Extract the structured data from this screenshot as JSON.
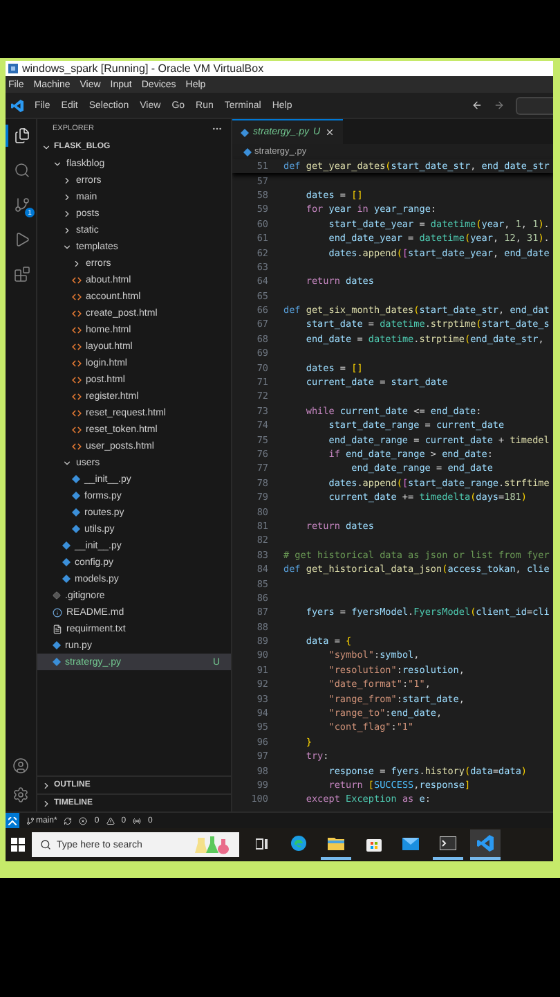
{
  "window": {
    "title": "windows_spark [Running] - Oracle VM VirtualBox"
  },
  "host_menu": [
    "File",
    "Machine",
    "View",
    "Input",
    "Devices",
    "Help"
  ],
  "menu": [
    "File",
    "Edit",
    "Selection",
    "View",
    "Go",
    "Run",
    "Terminal",
    "Help"
  ],
  "activity_bar": [
    {
      "kind": "files",
      "selected": true
    },
    {
      "kind": "search",
      "selected": false
    },
    {
      "kind": "source_control",
      "selected": false,
      "badge": "1"
    },
    {
      "kind": "run",
      "selected": false
    },
    {
      "kind": "extensions",
      "selected": false
    }
  ],
  "sidebar": {
    "title": "EXPLORER",
    "root": {
      "label": "FLASK_BLOG",
      "expanded": true,
      "children": [
        {
          "name": "flaskblog",
          "kind": "folder",
          "expanded": true,
          "selected": false,
          "children": [
            {
              "name": "errors",
              "kind": "folder",
              "expanded": false,
              "selected": false
            },
            {
              "name": "main",
              "kind": "folder",
              "expanded": false,
              "selected": false
            },
            {
              "name": "posts",
              "kind": "folder",
              "expanded": false,
              "selected": false
            },
            {
              "name": "static",
              "kind": "folder",
              "expanded": false,
              "selected": false
            },
            {
              "name": "templates",
              "kind": "folder",
              "expanded": true,
              "selected": false,
              "children": [
                {
                  "name": "errors",
                  "kind": "folder",
                  "expanded": false,
                  "selected": false
                },
                {
                  "name": "about.html",
                  "kind": "html",
                  "selected": false
                },
                {
                  "name": "account.html",
                  "kind": "html",
                  "selected": false
                },
                {
                  "name": "create_post.html",
                  "kind": "html",
                  "selected": false
                },
                {
                  "name": "home.html",
                  "kind": "html",
                  "selected": false
                },
                {
                  "name": "layout.html",
                  "kind": "html",
                  "selected": false
                },
                {
                  "name": "login.html",
                  "kind": "html",
                  "selected": false
                },
                {
                  "name": "post.html",
                  "kind": "html",
                  "selected": false
                },
                {
                  "name": "register.html",
                  "kind": "html",
                  "selected": false
                },
                {
                  "name": "reset_request.html",
                  "kind": "html",
                  "selected": false
                },
                {
                  "name": "reset_token.html",
                  "kind": "html",
                  "selected": false
                },
                {
                  "name": "user_posts.html",
                  "kind": "html",
                  "selected": false
                }
              ]
            },
            {
              "name": "users",
              "kind": "folder",
              "expanded": true,
              "selected": false,
              "children": [
                {
                  "name": "__init__.py",
                  "kind": "py",
                  "selected": false
                },
                {
                  "name": "forms.py",
                  "kind": "py",
                  "selected": false
                },
                {
                  "name": "routes.py",
                  "kind": "py",
                  "selected": false
                },
                {
                  "name": "utils.py",
                  "kind": "py",
                  "selected": false
                }
              ]
            },
            {
              "name": "__init__.py",
              "kind": "py",
              "selected": false
            },
            {
              "name": "config.py",
              "kind": "py",
              "selected": false
            },
            {
              "name": "models.py",
              "kind": "py",
              "selected": false
            }
          ]
        },
        {
          "name": ".gitignore",
          "kind": "gitignore",
          "selected": false
        },
        {
          "name": "README.md",
          "kind": "markdown",
          "selected": false
        },
        {
          "name": "requirment.txt",
          "kind": "text",
          "selected": false
        },
        {
          "name": "run.py",
          "kind": "py",
          "selected": false
        },
        {
          "name": "stratergy_.py",
          "kind": "py",
          "selected": true,
          "badge": "U"
        }
      ]
    },
    "sections": [
      {
        "label": "OUTLINE",
        "expanded": false
      },
      {
        "label": "TIMELINE",
        "expanded": false
      }
    ]
  },
  "editor": {
    "tabs": [
      {
        "label": "stratergy_.py",
        "badge": "U",
        "selected": true
      }
    ],
    "breadcrumb": "stratergy_.py",
    "sticky_line": {
      "number": "51",
      "tokens": [
        {
          "kind": "kw",
          "text": "def "
        },
        {
          "kind": "fn",
          "text": "get_year_dates"
        },
        {
          "kind": "b1",
          "text": "("
        },
        {
          "kind": "var",
          "text": "start_date_str"
        },
        {
          "kind": "p",
          "text": ", "
        },
        {
          "kind": "var",
          "text": "end_date_str"
        }
      ]
    },
    "lines": [
      {
        "number": "57"
      },
      {
        "number": "58",
        "tokens": [
          {
            "kind": "var",
            "text": "    dates"
          },
          {
            "kind": "p",
            "text": " = "
          },
          {
            "kind": "b1",
            "text": "[]"
          }
        ]
      },
      {
        "number": "59",
        "tokens": [
          {
            "kind": "ctl",
            "text": "    for "
          },
          {
            "kind": "var",
            "text": "year"
          },
          {
            "kind": "ctl",
            "text": " in "
          },
          {
            "kind": "var",
            "text": "year_range"
          },
          {
            "kind": "p",
            "text": ":"
          }
        ]
      },
      {
        "number": "60",
        "tokens": [
          {
            "kind": "var",
            "text": "        start_date_year"
          },
          {
            "kind": "p",
            "text": " = "
          },
          {
            "kind": "cls",
            "text": "datetime"
          },
          {
            "kind": "b1",
            "text": "("
          },
          {
            "kind": "var",
            "text": "year"
          },
          {
            "kind": "p",
            "text": ", "
          },
          {
            "kind": "num",
            "text": "1"
          },
          {
            "kind": "p",
            "text": ", "
          },
          {
            "kind": "num",
            "text": "1"
          },
          {
            "kind": "b1",
            "text": ")"
          },
          {
            "kind": "p",
            "text": "."
          }
        ]
      },
      {
        "number": "61",
        "tokens": [
          {
            "kind": "var",
            "text": "        end_date_year"
          },
          {
            "kind": "p",
            "text": " = "
          },
          {
            "kind": "cls",
            "text": "datetime"
          },
          {
            "kind": "b1",
            "text": "("
          },
          {
            "kind": "var",
            "text": "year"
          },
          {
            "kind": "p",
            "text": ", "
          },
          {
            "kind": "num",
            "text": "12"
          },
          {
            "kind": "p",
            "text": ", "
          },
          {
            "kind": "num",
            "text": "31"
          },
          {
            "kind": "b1",
            "text": ")"
          },
          {
            "kind": "p",
            "text": "."
          }
        ]
      },
      {
        "number": "62",
        "tokens": [
          {
            "kind": "var",
            "text": "        dates"
          },
          {
            "kind": "p",
            "text": "."
          },
          {
            "kind": "fn",
            "text": "append"
          },
          {
            "kind": "b1",
            "text": "("
          },
          {
            "kind": "b2",
            "text": "["
          },
          {
            "kind": "var",
            "text": "start_date_year"
          },
          {
            "kind": "p",
            "text": ", "
          },
          {
            "kind": "var",
            "text": "end_date"
          }
        ]
      },
      {
        "number": "63"
      },
      {
        "number": "64",
        "tokens": [
          {
            "kind": "ctl",
            "text": "    return "
          },
          {
            "kind": "var",
            "text": "dates"
          }
        ]
      },
      {
        "number": "65"
      },
      {
        "number": "66",
        "tokens": [
          {
            "kind": "kw",
            "text": "def "
          },
          {
            "kind": "fn",
            "text": "get_six_month_dates"
          },
          {
            "kind": "b1",
            "text": "("
          },
          {
            "kind": "var",
            "text": "start_date_str"
          },
          {
            "kind": "p",
            "text": ", "
          },
          {
            "kind": "var",
            "text": "end_dat"
          }
        ]
      },
      {
        "number": "67",
        "tokens": [
          {
            "kind": "var",
            "text": "    start_date"
          },
          {
            "kind": "p",
            "text": " = "
          },
          {
            "kind": "cls",
            "text": "datetime"
          },
          {
            "kind": "p",
            "text": "."
          },
          {
            "kind": "fn",
            "text": "strptime"
          },
          {
            "kind": "b1",
            "text": "("
          },
          {
            "kind": "var",
            "text": "start_date_s"
          }
        ]
      },
      {
        "number": "68",
        "tokens": [
          {
            "kind": "var",
            "text": "    end_date"
          },
          {
            "kind": "p",
            "text": " = "
          },
          {
            "kind": "cls",
            "text": "datetime"
          },
          {
            "kind": "p",
            "text": "."
          },
          {
            "kind": "fn",
            "text": "strptime"
          },
          {
            "kind": "b1",
            "text": "("
          },
          {
            "kind": "var",
            "text": "end_date_str"
          },
          {
            "kind": "p",
            "text": ","
          }
        ]
      },
      {
        "number": "69"
      },
      {
        "number": "70",
        "tokens": [
          {
            "kind": "var",
            "text": "    dates"
          },
          {
            "kind": "p",
            "text": " = "
          },
          {
            "kind": "b1",
            "text": "[]"
          }
        ]
      },
      {
        "number": "71",
        "tokens": [
          {
            "kind": "var",
            "text": "    current_date"
          },
          {
            "kind": "p",
            "text": " = "
          },
          {
            "kind": "var",
            "text": "start_date"
          }
        ]
      },
      {
        "number": "72"
      },
      {
        "number": "73",
        "tokens": [
          {
            "kind": "ctl",
            "text": "    while "
          },
          {
            "kind": "var",
            "text": "current_date"
          },
          {
            "kind": "p",
            "text": " <= "
          },
          {
            "kind": "var",
            "text": "end_date"
          },
          {
            "kind": "p",
            "text": ":"
          }
        ]
      },
      {
        "number": "74",
        "tokens": [
          {
            "kind": "var",
            "text": "        start_date_range"
          },
          {
            "kind": "p",
            "text": " = "
          },
          {
            "kind": "var",
            "text": "current_date"
          }
        ]
      },
      {
        "number": "75",
        "tokens": [
          {
            "kind": "var",
            "text": "        end_date_range"
          },
          {
            "kind": "p",
            "text": " = "
          },
          {
            "kind": "var",
            "text": "current_date"
          },
          {
            "kind": "p",
            "text": " + "
          },
          {
            "kind": "fn",
            "text": "timedel"
          }
        ]
      },
      {
        "number": "76",
        "tokens": [
          {
            "kind": "ctl",
            "text": "        if "
          },
          {
            "kind": "var",
            "text": "end_date_range"
          },
          {
            "kind": "p",
            "text": " > "
          },
          {
            "kind": "var",
            "text": "end_date"
          },
          {
            "kind": "p",
            "text": ":"
          }
        ]
      },
      {
        "number": "77",
        "tokens": [
          {
            "kind": "var",
            "text": "            end_date_range"
          },
          {
            "kind": "p",
            "text": " = "
          },
          {
            "kind": "var",
            "text": "end_date"
          }
        ]
      },
      {
        "number": "78",
        "tokens": [
          {
            "kind": "var",
            "text": "        dates"
          },
          {
            "kind": "p",
            "text": "."
          },
          {
            "kind": "fn",
            "text": "append"
          },
          {
            "kind": "b1",
            "text": "("
          },
          {
            "kind": "b2",
            "text": "["
          },
          {
            "kind": "var",
            "text": "start_date_range"
          },
          {
            "kind": "p",
            "text": "."
          },
          {
            "kind": "fn",
            "text": "strftime"
          }
        ]
      },
      {
        "number": "79",
        "tokens": [
          {
            "kind": "var",
            "text": "        current_date"
          },
          {
            "kind": "p",
            "text": " += "
          },
          {
            "kind": "cls",
            "text": "timedelta"
          },
          {
            "kind": "b1",
            "text": "("
          },
          {
            "kind": "var",
            "text": "days"
          },
          {
            "kind": "p",
            "text": "="
          },
          {
            "kind": "num",
            "text": "181"
          },
          {
            "kind": "b1",
            "text": ")"
          }
        ]
      },
      {
        "number": "80"
      },
      {
        "number": "81",
        "tokens": [
          {
            "kind": "ctl",
            "text": "    return "
          },
          {
            "kind": "var",
            "text": "dates"
          }
        ]
      },
      {
        "number": "82"
      },
      {
        "number": "83",
        "tokens": [
          {
            "kind": "cmt",
            "text": "# get historical data as json or list from fyer"
          }
        ]
      },
      {
        "number": "84",
        "tokens": [
          {
            "kind": "kw",
            "text": "def "
          },
          {
            "kind": "fn",
            "text": "get_historical_data_json"
          },
          {
            "kind": "b1",
            "text": "("
          },
          {
            "kind": "var",
            "text": "access_tokan"
          },
          {
            "kind": "p",
            "text": ", "
          },
          {
            "kind": "var",
            "text": "clie"
          }
        ]
      },
      {
        "number": "85"
      },
      {
        "number": "86"
      },
      {
        "number": "87",
        "tokens": [
          {
            "kind": "var",
            "text": "    fyers"
          },
          {
            "kind": "p",
            "text": " = "
          },
          {
            "kind": "var",
            "text": "fyersModel"
          },
          {
            "kind": "p",
            "text": "."
          },
          {
            "kind": "cls",
            "text": "FyersModel"
          },
          {
            "kind": "b1",
            "text": "("
          },
          {
            "kind": "var",
            "text": "client_id"
          },
          {
            "kind": "p",
            "text": "="
          },
          {
            "kind": "var",
            "text": "cli"
          }
        ]
      },
      {
        "number": "88"
      },
      {
        "number": "89",
        "tokens": [
          {
            "kind": "var",
            "text": "    data"
          },
          {
            "kind": "p",
            "text": " = "
          },
          {
            "kind": "b1",
            "text": "{"
          }
        ]
      },
      {
        "number": "90",
        "tokens": [
          {
            "kind": "str",
            "text": "        \"symbol\""
          },
          {
            "kind": "p",
            "text": ":"
          },
          {
            "kind": "var",
            "text": "symbol"
          },
          {
            "kind": "p",
            "text": ","
          }
        ]
      },
      {
        "number": "91",
        "tokens": [
          {
            "kind": "str",
            "text": "        \"resolution\""
          },
          {
            "kind": "p",
            "text": ":"
          },
          {
            "kind": "var",
            "text": "resolution"
          },
          {
            "kind": "p",
            "text": ","
          }
        ]
      },
      {
        "number": "92",
        "tokens": [
          {
            "kind": "str",
            "text": "        \"date_format\""
          },
          {
            "kind": "p",
            "text": ":"
          },
          {
            "kind": "str",
            "text": "\"1\""
          },
          {
            "kind": "p",
            "text": ","
          }
        ]
      },
      {
        "number": "93",
        "tokens": [
          {
            "kind": "str",
            "text": "        \"range_from\""
          },
          {
            "kind": "p",
            "text": ":"
          },
          {
            "kind": "var",
            "text": "start_date"
          },
          {
            "kind": "p",
            "text": ","
          }
        ]
      },
      {
        "number": "94",
        "tokens": [
          {
            "kind": "str",
            "text": "        \"range_to\""
          },
          {
            "kind": "p",
            "text": ":"
          },
          {
            "kind": "var",
            "text": "end_date"
          },
          {
            "kind": "p",
            "text": ","
          }
        ]
      },
      {
        "number": "95",
        "tokens": [
          {
            "kind": "str",
            "text": "        \"cont_flag\""
          },
          {
            "kind": "p",
            "text": ":"
          },
          {
            "kind": "str",
            "text": "\"1\""
          }
        ]
      },
      {
        "number": "96",
        "tokens": [
          {
            "kind": "b1",
            "text": "    }"
          }
        ]
      },
      {
        "number": "97",
        "tokens": [
          {
            "kind": "ctl",
            "text": "    try"
          },
          {
            "kind": "p",
            "text": ":"
          }
        ]
      },
      {
        "number": "98",
        "tokens": [
          {
            "kind": "var",
            "text": "        response"
          },
          {
            "kind": "p",
            "text": " = "
          },
          {
            "kind": "var",
            "text": "fyers"
          },
          {
            "kind": "p",
            "text": "."
          },
          {
            "kind": "fn",
            "text": "history"
          },
          {
            "kind": "b1",
            "text": "("
          },
          {
            "kind": "var",
            "text": "data"
          },
          {
            "kind": "p",
            "text": "="
          },
          {
            "kind": "var",
            "text": "data"
          },
          {
            "kind": "b1",
            "text": ")"
          }
        ]
      },
      {
        "number": "99",
        "tokens": [
          {
            "kind": "ctl",
            "text": "        return "
          },
          {
            "kind": "b1",
            "text": "["
          },
          {
            "kind": "const",
            "text": "SUCCESS"
          },
          {
            "kind": "p",
            "text": ","
          },
          {
            "kind": "var",
            "text": "response"
          },
          {
            "kind": "b1",
            "text": "]"
          }
        ]
      },
      {
        "number": "100",
        "tokens": [
          {
            "kind": "ctl",
            "text": "    except "
          },
          {
            "kind": "cls",
            "text": "Exception"
          },
          {
            "kind": "ctl",
            "text": " as "
          },
          {
            "kind": "var",
            "text": "e"
          },
          {
            "kind": "p",
            "text": ":"
          }
        ]
      }
    ]
  },
  "status_bar": {
    "branch": "main*",
    "errors": "0",
    "warnings": "0",
    "ports": "0"
  },
  "taskbar": {
    "search_placeholder": "Type here to search",
    "apps": [
      {
        "kind": "task_view",
        "running": false,
        "selected": false
      },
      {
        "kind": "browser",
        "running": false,
        "selected": false
      },
      {
        "kind": "folder",
        "running": true,
        "selected": false
      },
      {
        "kind": "store",
        "running": false,
        "selected": false
      },
      {
        "kind": "mail",
        "running": false,
        "selected": false
      },
      {
        "kind": "terminal",
        "running": true,
        "selected": false
      },
      {
        "kind": "code_editor",
        "running": true,
        "selected": true
      }
    ]
  }
}
